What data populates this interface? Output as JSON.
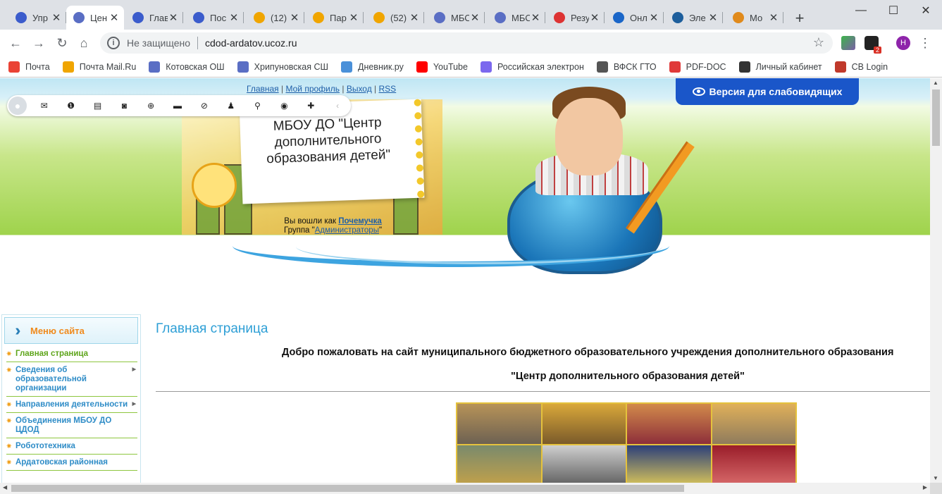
{
  "tabs": [
    {
      "label": "Упр",
      "fav": "ucoz",
      "color": "#3b5ccc"
    },
    {
      "label": "Цен",
      "fav": "compass",
      "color": "#5a6ec4",
      "active": true
    },
    {
      "label": "Глав",
      "fav": "ucoz",
      "color": "#3b5ccc"
    },
    {
      "label": "Пос",
      "fav": "ucoz",
      "color": "#3b5ccc"
    },
    {
      "label": "(12)",
      "fav": "mail-ru",
      "color": "#f0a500"
    },
    {
      "label": "Пар",
      "fav": "mail-ru",
      "color": "#f0a500"
    },
    {
      "label": "(52)",
      "fav": "mail-ru",
      "color": "#f0a500"
    },
    {
      "label": "МБС",
      "fav": "compass",
      "color": "#5a6ec4"
    },
    {
      "label": "МБС",
      "fav": "compass",
      "color": "#5a6ec4"
    },
    {
      "label": "Резу",
      "fav": "chart",
      "color": "#d33"
    },
    {
      "label": "Онл",
      "fav": "house",
      "color": "#1a66c8"
    },
    {
      "label": "Эле",
      "fav": "figure",
      "color": "#1d5e9c"
    },
    {
      "label": "Мо",
      "fav": "hand",
      "color": "#e08a1c"
    }
  ],
  "window": {
    "minimize": "—",
    "maximize": "☐",
    "close": "✕",
    "newtab": "+",
    "tab_close": "✕"
  },
  "address": {
    "security": "Не защищено",
    "url": "cdod-ardatov.ucoz.ru",
    "star": "☆",
    "profile_letter": "Н",
    "ext_badge": "2"
  },
  "bookmarks": [
    {
      "label": "Почта",
      "color": "#ea4335"
    },
    {
      "label": "Почта Mail.Ru",
      "color": "#f0a500"
    },
    {
      "label": "Котовская ОШ",
      "color": "#5a6ec4"
    },
    {
      "label": "Хрипуновская СШ",
      "color": "#5a6ec4"
    },
    {
      "label": "Дневник.ру",
      "color": "#4a90d9"
    },
    {
      "label": "YouTube",
      "color": "#ff0000"
    },
    {
      "label": "Российская электрон",
      "color": "#7b68ee"
    },
    {
      "label": "ВФСК ГТО",
      "color": "#555555"
    },
    {
      "label": "PDF-DOC",
      "color": "#e03a3a"
    },
    {
      "label": "Личный кабинет",
      "color": "#333333"
    },
    {
      "label": "CB Login",
      "color": "#c0392b"
    }
  ],
  "site": {
    "topnav": [
      "Главная",
      "Мой профиль",
      "Выход",
      "RSS"
    ],
    "low_vision": "Версия для слабовидящих",
    "title": "МБОУ ДО \"Центр дополнительного образования детей\"",
    "logged_prefix": "Вы вошли как",
    "username": "Почемучка",
    "group_prefix": "Группа \"",
    "group": "Администраторы",
    "group_suffix": "\""
  },
  "menu": {
    "title": "Меню сайта",
    "items": [
      {
        "label": "Главная страница",
        "current": true,
        "sub": false
      },
      {
        "label": "Сведения об образовательной организации",
        "sub": true
      },
      {
        "label": "Направления деятельности",
        "sub": true
      },
      {
        "label": "Объединения МБОУ ДО ЦДОД",
        "sub": false
      },
      {
        "label": "Робототехника",
        "sub": false
      },
      {
        "label": "Ардатовская районная",
        "sub": false
      }
    ]
  },
  "main": {
    "heading": "Главная страница",
    "welcome_line1": "Добро пожаловать на сайт муниципального бюджетного образовательного учреждения дополнительного образования",
    "welcome_line2": "\"Центр дополнительного образования детей\""
  },
  "colors": {
    "accent": "#2e9fd6",
    "menu_title": "#f08a1c",
    "low_vision_bg": "#1a56c9"
  }
}
